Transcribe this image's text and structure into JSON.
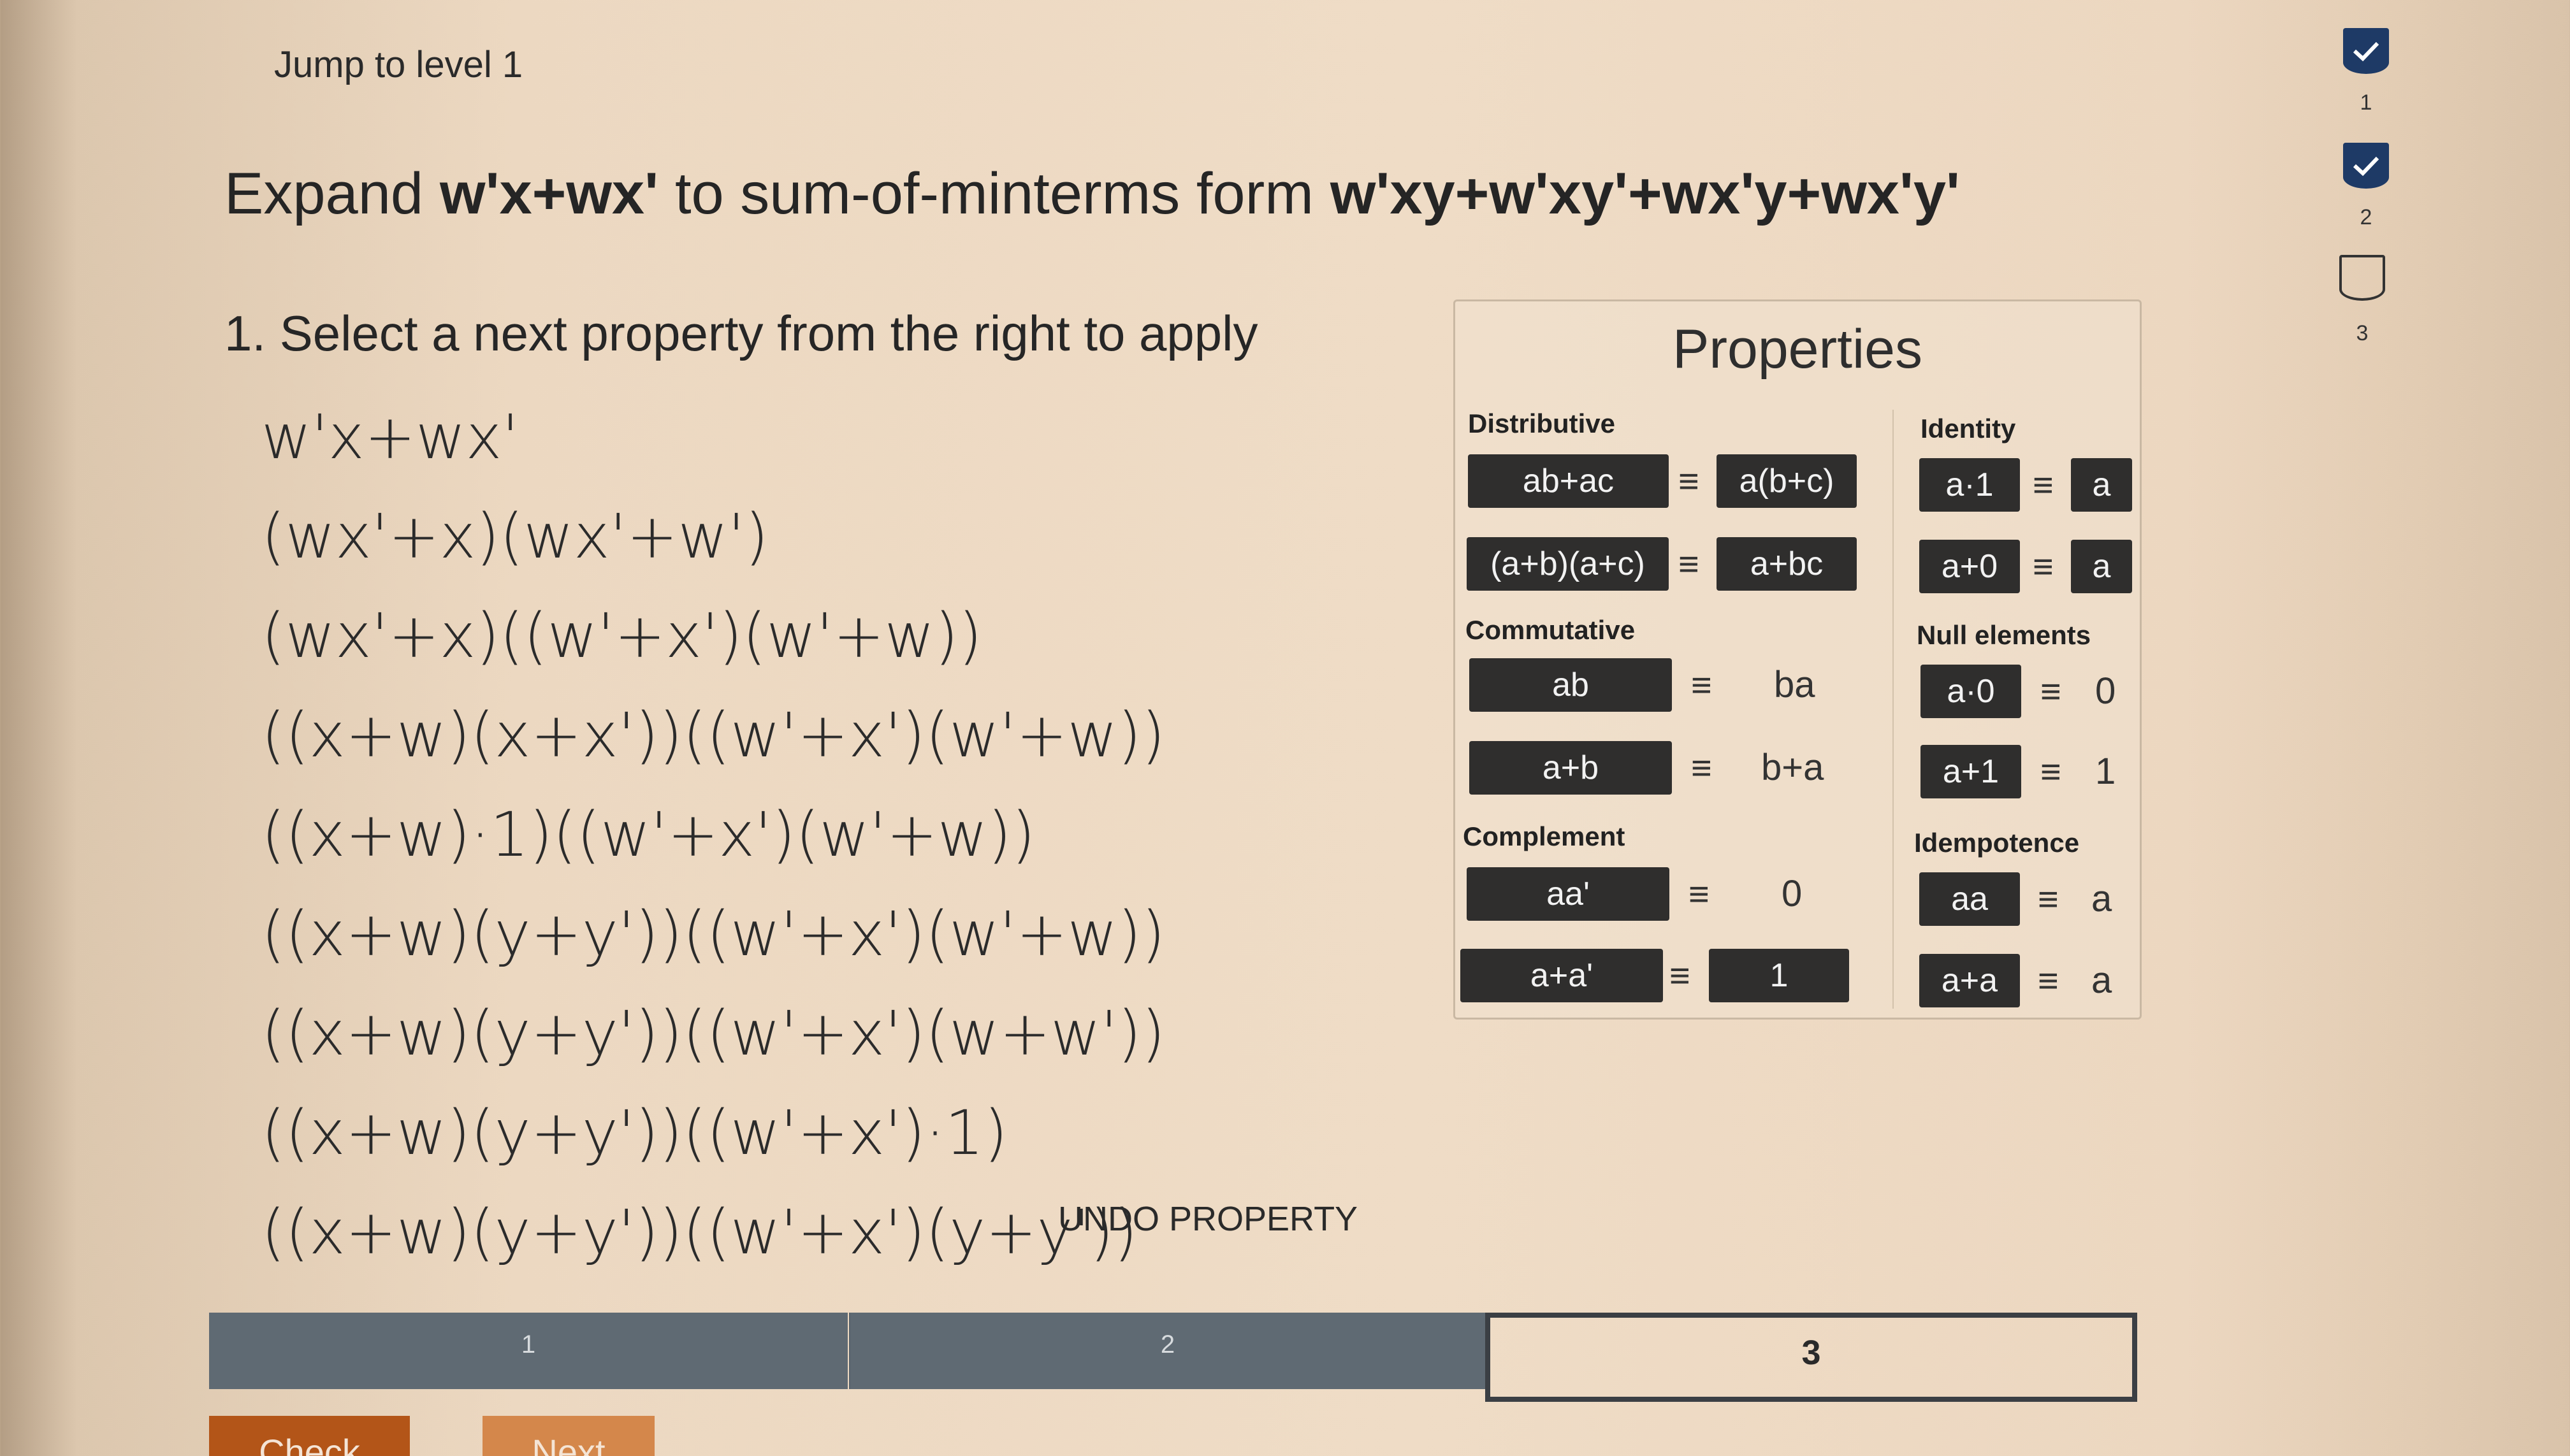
{
  "jump_link": "Jump to level 1",
  "heading": {
    "prefix": "Expand",
    "source_expr": "w'x+wx'",
    "middle": "to sum-of-minterms form",
    "target_expr": "w'xy+w'xy'+wx'y+wx'y'"
  },
  "step_title": "1. Select a next property from the right to apply",
  "expressions": [
    "w'x+wx'",
    "(wx'+x)(wx'+w')",
    "(wx'+x)((w'+x')(w'+w))",
    "((x+w)(x+x'))((w'+x')(w'+w))",
    "((x+w)·1)((w'+x')(w'+w))",
    "((x+w)(y+y'))((w'+x')(w'+w))",
    "((x+w)(y+y'))((w'+x')(w+w'))",
    "((x+w)(y+y'))((w'+x')·1)",
    "((x+w)(y+y'))((w'+x')(y+y'))"
  ],
  "undo_label": "UNDO PROPERTY",
  "properties": {
    "title": "Properties",
    "equiv": "≡",
    "distributive": {
      "label": "Distributive",
      "r1_left": "ab+ac",
      "r1_right": "a(b+c)",
      "r2_left": "(a+b)(a+c)",
      "r2_right": "a+bc"
    },
    "commutative": {
      "label": "Commutative",
      "r1_left": "ab",
      "r1_right": "ba",
      "r2_left": "a+b",
      "r2_right": "b+a"
    },
    "complement": {
      "label": "Complement",
      "r1_left": "aa'",
      "r1_right": "0",
      "r2_left": "a+a'",
      "r2_right": "1"
    },
    "identity": {
      "label": "Identity",
      "r1_left": "a·1",
      "r1_right": "a",
      "r2_left": "a+0",
      "r2_right": "a"
    },
    "null_elements": {
      "label": "Null elements",
      "r1_left": "a·0",
      "r1_right": "0",
      "r2_left": "a+1",
      "r2_right": "1"
    },
    "idempotence": {
      "label": "Idempotence",
      "r1_left": "aa",
      "r1_right": "a",
      "r2_left": "a+a",
      "r2_right": "a"
    }
  },
  "level_rail": [
    "1",
    "2",
    "3"
  ],
  "progress": [
    "1",
    "2",
    "3"
  ],
  "buttons": {
    "check": "Check",
    "next": "Next"
  }
}
